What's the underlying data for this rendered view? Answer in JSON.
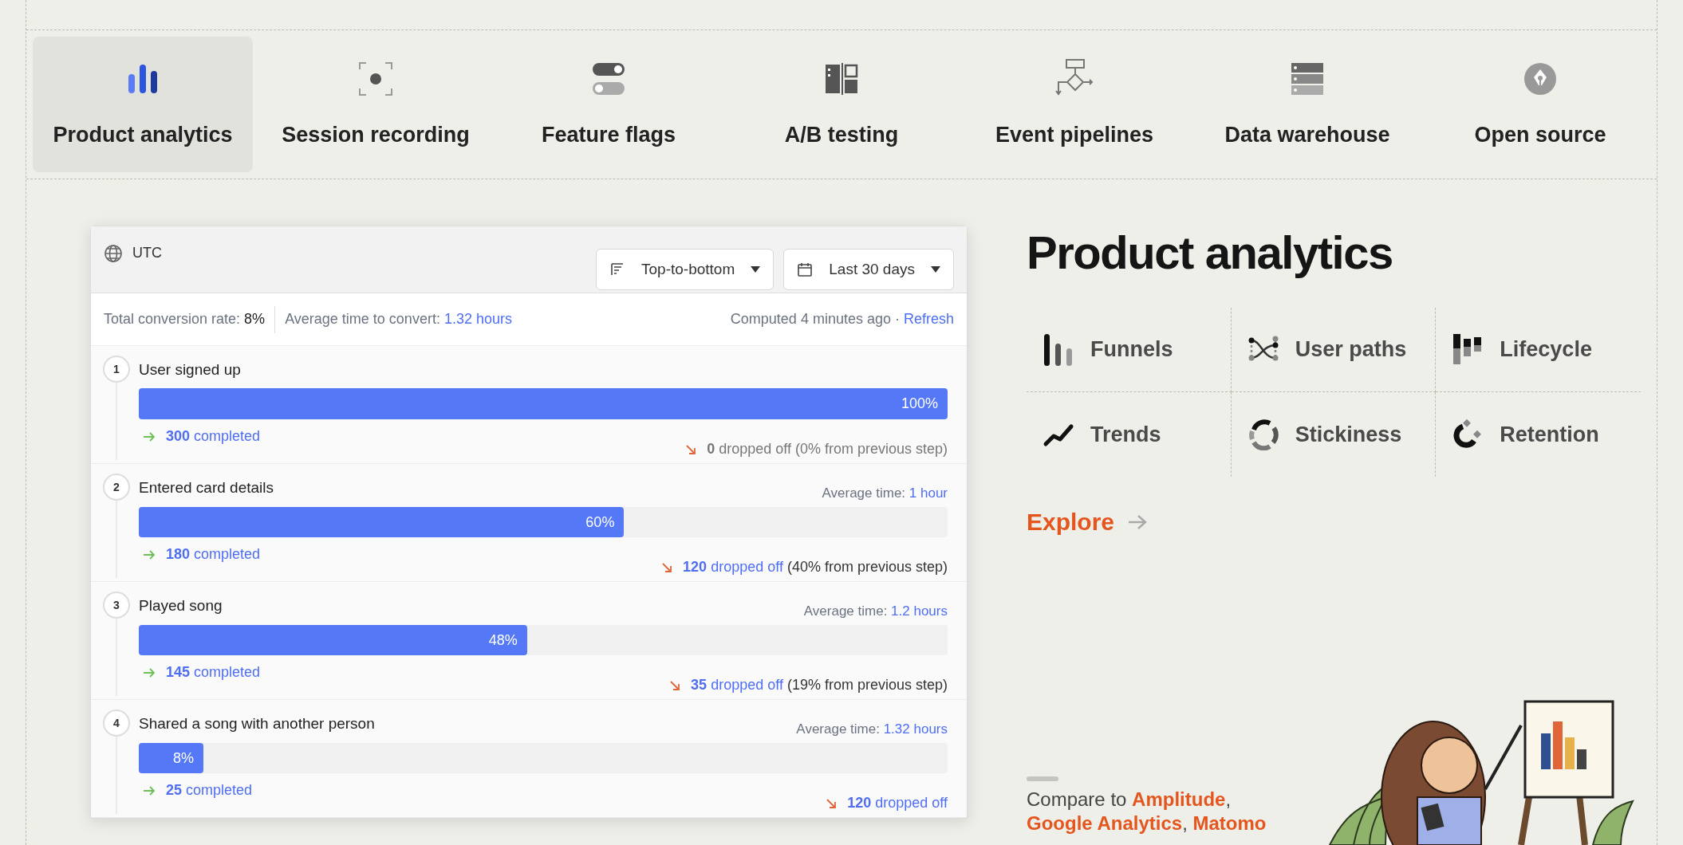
{
  "nav": {
    "tabs": [
      {
        "label": "Product analytics",
        "selected": true
      },
      {
        "label": "Session recording",
        "selected": false
      },
      {
        "label": "Feature flags",
        "selected": false
      },
      {
        "label": "A/B testing",
        "selected": false
      },
      {
        "label": "Event pipelines",
        "selected": false
      },
      {
        "label": "Data warehouse",
        "selected": false
      },
      {
        "label": "Open source",
        "selected": false
      }
    ]
  },
  "funnel": {
    "timezone": "UTC",
    "ordering": "Top-to-bottom",
    "date_range": "Last 30 days",
    "conversion_label": "Total conversion rate:",
    "conversion_value": "8%",
    "avg_label": "Average time to convert:",
    "avg_value": "1.32 hours",
    "computed": "Computed 4 minutes ago ·",
    "refresh": "Refresh",
    "steps": [
      {
        "number": "1",
        "name": "User signed up",
        "level": 1,
        "percent": "100%",
        "completed_count": "300",
        "completed_label": "completed",
        "dropped_count": "0",
        "dropped_label": "dropped off",
        "dropped_note": "(0% from previous step)",
        "dropped_muted": true
      },
      {
        "number": "2",
        "name": "Entered card details",
        "avg_label": "Average time:",
        "avg_value": "1 hour",
        "level": 0.6,
        "percent": "60%",
        "completed_count": "180",
        "completed_label": "completed",
        "dropped_count": "120",
        "dropped_label": "dropped off",
        "dropped_note": "(40% from previous step)",
        "dropped_muted": false
      },
      {
        "number": "3",
        "name": "Played song",
        "avg_label": "Average time:",
        "avg_value": "1.2 hours",
        "level": 0.48,
        "percent": "48%",
        "completed_count": "145",
        "completed_label": "completed",
        "dropped_count": "35",
        "dropped_label": "dropped off",
        "dropped_note": "(19% from previous step)",
        "dropped_muted": false
      },
      {
        "number": "4",
        "name": "Shared a song with another person",
        "avg_label": "Average time:",
        "avg_value": "1.32 hours",
        "level": 0.08,
        "percent": "8%",
        "completed_count": "25",
        "completed_label": "completed",
        "dropped_count": "120",
        "dropped_label": "dropped off",
        "dropped_muted": false
      }
    ]
  },
  "product": {
    "title": "Product analytics",
    "features": [
      "Funnels",
      "User paths",
      "Lifecycle",
      "Trends",
      "Stickiness",
      "Retention"
    ],
    "explore": "Explore",
    "compare": {
      "text": "Compare to",
      "links": [
        {
          "label": "Amplitude",
          "after": ","
        },
        {
          "label": "Google Analytics",
          "after": ","
        },
        {
          "label": "Matomo"
        }
      ]
    }
  }
}
